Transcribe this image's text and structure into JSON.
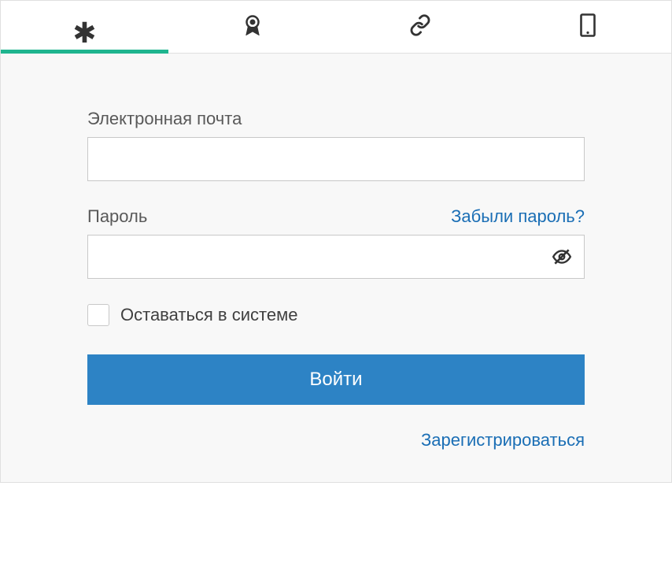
{
  "tabs": {
    "password": "asterisk",
    "certificate": "ribbon",
    "sso": "link",
    "mobile": "phone"
  },
  "form": {
    "email_label": "Электронная почта",
    "email_value": "",
    "password_label": "Пароль",
    "password_value": "",
    "forgot_password": "Забыли пароль?",
    "stay_logged_in": "Оставаться в системе",
    "login_button": "Войти",
    "register_link": "Зарегистрироваться"
  },
  "colors": {
    "accent_tab": "#1fb58f",
    "primary_button": "#2d83c5",
    "link": "#1a6eb5"
  }
}
